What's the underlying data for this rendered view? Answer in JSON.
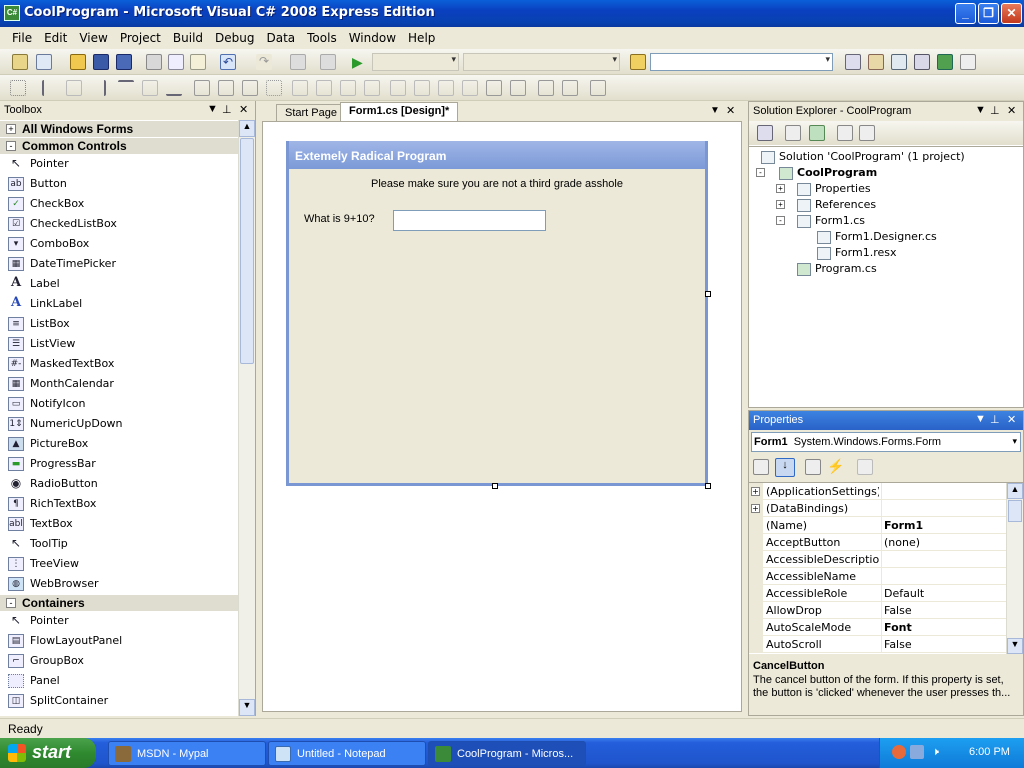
{
  "window": {
    "title": "CoolProgram - Microsoft Visual C# 2008 Express Edition",
    "icon": "csharp-project-icon"
  },
  "menu": [
    "File",
    "Edit",
    "View",
    "Project",
    "Build",
    "Debug",
    "Data",
    "Tools",
    "Window",
    "Help"
  ],
  "toolbox": {
    "title": "Toolbox",
    "sections": [
      {
        "label": "All Windows Forms",
        "state": "+"
      },
      {
        "label": "Common Controls",
        "state": "-"
      }
    ],
    "common_controls": [
      "Pointer",
      "Button",
      "CheckBox",
      "CheckedListBox",
      "ComboBox",
      "DateTimePicker",
      "Label",
      "LinkLabel",
      "ListBox",
      "ListView",
      "MaskedTextBox",
      "MonthCalendar",
      "NotifyIcon",
      "NumericUpDown",
      "PictureBox",
      "ProgressBar",
      "RadioButton",
      "RichTextBox",
      "TextBox",
      "ToolTip",
      "TreeView",
      "WebBrowser"
    ],
    "containers_label": "Containers",
    "containers": [
      "Pointer",
      "FlowLayoutPanel",
      "GroupBox",
      "Panel",
      "SplitContainer"
    ]
  },
  "doc": {
    "tabs": [
      {
        "label": "Start Page"
      },
      {
        "label": "Form1.cs [Design]*"
      }
    ],
    "form": {
      "title": "Extemely Radical Program",
      "message": "Please make sure you are not a third grade asshole",
      "question": "What is 9+10?",
      "answer": ""
    }
  },
  "solution_explorer": {
    "title": "Solution Explorer - CoolProgram",
    "solution": "Solution 'CoolProgram' (1 project)",
    "project": "CoolProgram",
    "items": [
      "Properties",
      "References",
      "Form1.cs",
      "Form1.Designer.cs",
      "Form1.resx",
      "Program.cs"
    ]
  },
  "properties": {
    "title": "Properties",
    "object_name": "Form1",
    "object_type": "System.Windows.Forms.Form",
    "rows": [
      {
        "name": "(ApplicationSettings)",
        "value": "",
        "expand": "+"
      },
      {
        "name": "(DataBindings)",
        "value": "",
        "expand": "+"
      },
      {
        "name": "(Name)",
        "value": "Form1",
        "bold": true
      },
      {
        "name": "AcceptButton",
        "value": "(none)"
      },
      {
        "name": "AccessibleDescription",
        "value": ""
      },
      {
        "name": "AccessibleName",
        "value": ""
      },
      {
        "name": "AccessibleRole",
        "value": "Default"
      },
      {
        "name": "AllowDrop",
        "value": "False"
      },
      {
        "name": "AutoScaleMode",
        "value": "Font",
        "bold": true
      },
      {
        "name": "AutoScroll",
        "value": "False"
      }
    ],
    "desc_title": "CancelButton",
    "desc_text": "The cancel button of the form. If this property is set, the button is 'clicked' whenever the user presses th..."
  },
  "status": "Ready",
  "taskbar": {
    "start": "start",
    "tasks": [
      "MSDN - Mypal",
      "Untitled - Notepad",
      "CoolProgram - Micros..."
    ],
    "clock": "6:00 PM"
  }
}
